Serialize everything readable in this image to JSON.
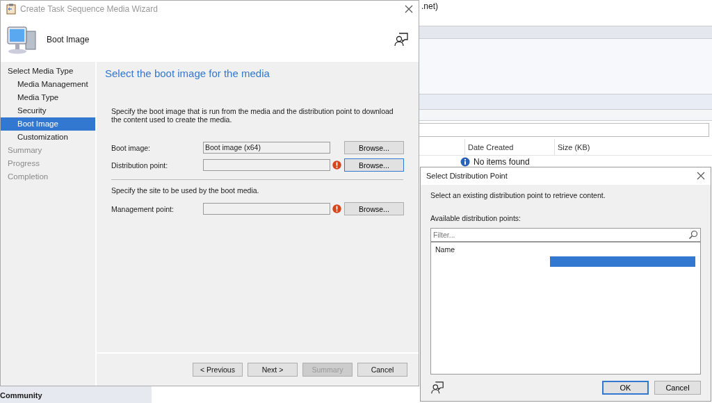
{
  "background_window": {
    "title": ".net)",
    "columns": [
      "Date Created",
      "Size (KB)"
    ],
    "empty_message": "No items found",
    "nav_item": "Community"
  },
  "wizard": {
    "title": "Create Task Sequence Media Wizard",
    "page_title": "Boot Image",
    "steps": [
      {
        "label": "Select Media Type",
        "selected": false,
        "disabled": false,
        "children": [
          {
            "label": "Media Management",
            "selected": false,
            "disabled": false
          },
          {
            "label": "Media Type",
            "selected": false,
            "disabled": false
          },
          {
            "label": "Security",
            "selected": false,
            "disabled": false
          },
          {
            "label": "Boot Image",
            "selected": true,
            "disabled": false
          },
          {
            "label": "Customization",
            "selected": false,
            "disabled": false
          }
        ]
      },
      {
        "label": "Summary",
        "selected": false,
        "disabled": true
      },
      {
        "label": "Progress",
        "selected": false,
        "disabled": true
      },
      {
        "label": "Completion",
        "selected": false,
        "disabled": true
      }
    ],
    "heading": "Select the boot image for the media",
    "sections": [
      {
        "description": "Specify the boot image that is run from the media and the distribution point to download the content used to create the media.",
        "fields": [
          {
            "label": "Boot image:",
            "value": "Boot image (x64)",
            "error": false,
            "button": "Browse...",
            "focused": false
          },
          {
            "label": "Distribution point:",
            "error": true,
            "button": "Browse...",
            "focused": true
          }
        ]
      },
      {
        "description": "Specify the site to be used by the boot media.",
        "fields": [
          {
            "label": "Management point:",
            "error": true,
            "button": "Browse...",
            "focused": false
          }
        ]
      }
    ],
    "buttons": [
      {
        "label": "< Previous",
        "disabled": false
      },
      {
        "label": "Next >",
        "disabled": false
      },
      {
        "label": "Summary",
        "disabled": true
      },
      {
        "label": "Cancel",
        "disabled": false
      }
    ]
  },
  "dialog": {
    "title": "Select Distribution Point",
    "instruction": "Select an existing distribution point to retrieve content.",
    "list_label": "Available distribution points:",
    "filter": {
      "placeholder": "Filter..."
    },
    "column": "Name",
    "rows": [
      {
        "selected": true
      }
    ],
    "buttons": [
      {
        "label": "OK",
        "focused": true
      },
      {
        "label": "Cancel",
        "focused": false
      }
    ]
  }
}
